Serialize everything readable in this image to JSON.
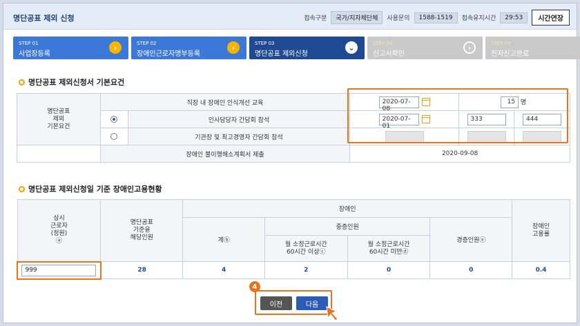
{
  "header": {
    "title": "명단공표 제외 신청",
    "conn_type_label": "접속구분",
    "conn_type_value": "국가/지자체단체",
    "inquiry_label": "사용문의",
    "inquiry_value": "1588-1519",
    "session_label": "접속유지시간",
    "session_value": "29:53",
    "extend_button": "시간연장"
  },
  "steps": [
    {
      "num": "STEP 01",
      "label": "사업장등록"
    },
    {
      "num": "STEP 02",
      "label": "장애인근로자명부등록"
    },
    {
      "num": "STEP 03",
      "label": "명단공표 제외신청"
    },
    {
      "num": "STEP 04",
      "label": "신고서확인"
    },
    {
      "num": "STEP 05",
      "label": "전자신고완료"
    }
  ],
  "section1": {
    "title": "명단공표 제외신청서 기본요건",
    "row_header": "명단공표\n제외\n기본요건",
    "row1_label": "직장 내 장애인 인식개선 교육",
    "row1_date": "2020-07-08",
    "row1_count": "15",
    "row1_unit": "명",
    "row2_label": "인사담당자 간담회 참석",
    "row2_date": "2020-07-01",
    "row2_v1": "333",
    "row2_v2": "444",
    "row3_label": "기관장 및 최고경영자 간담회 참석",
    "row4_label": "장애인 불이행해소계획서 제출",
    "row4_date": "2020-09-08"
  },
  "section2": {
    "title": "명단공표 제외신청일 기준 장애인고용현황",
    "col_regular": "상시\n근로자\n(정원)\nⓐ",
    "col_target": "명단공표\n기준을\n해당인원",
    "col_disabled": "장애인",
    "col_total": "계ⓑ",
    "col_severe": "중증인원",
    "col_severe_over": "월 소정근로시간\n60시간 이상ⓒ",
    "col_severe_under": "월 소정근로시간\n60시간 미만ⓓ",
    "col_mild": "경증인원ⓔ",
    "col_rate": "장애인\n고용률",
    "regular_input": "999",
    "target_value": "28",
    "total_value": "4",
    "severe_over_value": "2",
    "severe_under_value": "0",
    "mild_value": "0",
    "rate_value": "0.4"
  },
  "footer": {
    "badge": "4",
    "prev_button": "이전",
    "next_button": "다음"
  }
}
